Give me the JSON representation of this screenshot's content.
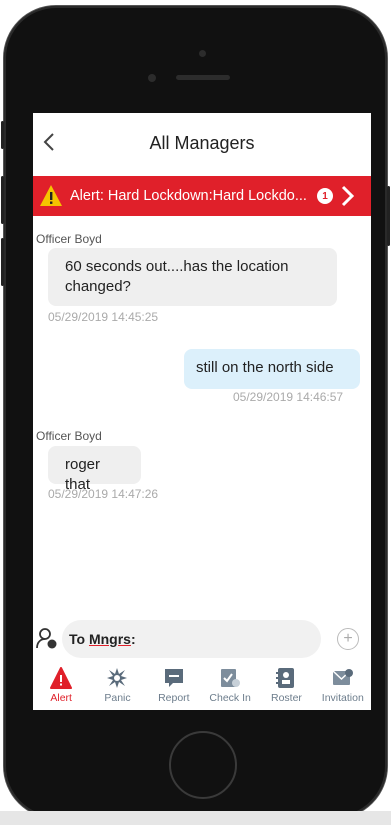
{
  "header": {
    "title": "All Managers"
  },
  "alert": {
    "text": "Alert: Hard Lockdown:Hard Lockdo...",
    "count": "1"
  },
  "messages": [
    {
      "sender": "Officer Boyd",
      "text": "60 seconds out....has the location changed?",
      "time": "05/29/2019 14:45:25",
      "direction": "in"
    },
    {
      "sender": "",
      "text": "still on the north side",
      "time": "05/29/2019 14:46:57",
      "direction": "out"
    },
    {
      "sender": "Officer Boyd",
      "text": "roger that",
      "time": "05/29/2019 14:47:26",
      "direction": "in"
    }
  ],
  "composer": {
    "to_prefix": "To ",
    "to_target": "Mngrs",
    "to_suffix": ":"
  },
  "tabs": [
    {
      "label": "Alert",
      "icon": "alert-icon",
      "active": true
    },
    {
      "label": "Panic",
      "icon": "panic-icon",
      "active": false
    },
    {
      "label": "Report",
      "icon": "report-icon",
      "active": false
    },
    {
      "label": "Check In",
      "icon": "check-in-icon",
      "active": false
    },
    {
      "label": "Roster",
      "icon": "roster-icon",
      "active": false
    },
    {
      "label": "Invitation",
      "icon": "invitation-icon",
      "active": false
    }
  ],
  "colors": {
    "accent": "#e0202a",
    "incoming": "#efefef",
    "outgoing": "#dcf0fb",
    "tab_inactive": "#6d7d8c"
  }
}
